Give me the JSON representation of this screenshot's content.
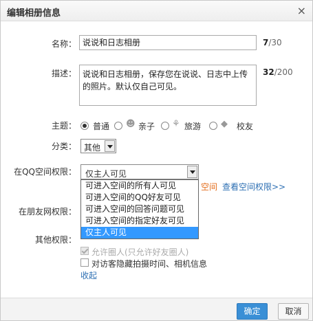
{
  "dialog": {
    "title": "编辑相册信息",
    "close_icon": "×"
  },
  "form": {
    "name_label": "名称：",
    "name_value": "说说和日志相册",
    "name_count_current": "7",
    "name_count_max": "/30",
    "desc_label": "描述：",
    "desc_value": "说说和日志相册，保存您在说说、日志中上传的照片。默认仅自己可见。",
    "desc_count_current": "32",
    "desc_count_max": "/200",
    "theme_label": "主题：",
    "themes": [
      {
        "label": "普通",
        "selected": true,
        "icon": ""
      },
      {
        "label": "亲子",
        "selected": false,
        "icon": "baby-icon"
      },
      {
        "label": "旅游",
        "selected": false,
        "icon": "palm-tree-icon"
      },
      {
        "label": "校友",
        "selected": false,
        "icon": "graduation-cap-icon"
      }
    ],
    "category_label": "分类：",
    "category_value": "其他",
    "qq_permission_label": "在QQ空间权限：",
    "qq_permission_value": "仅主人可见",
    "permission_options": [
      "可进入空间的所有人可见",
      "可进入空间的QQ好友可见",
      "可进入空间的回答问题可见",
      "可进入空间的指定好友可见",
      "仅主人可见"
    ],
    "space_link_partial": "空间",
    "view_space_permission_link": "查看空间权限>>",
    "friends_permission_label": "在朋友网权限：",
    "other_permission_label": "其他权限：",
    "allow_circle_label": "允许圈人(只允许好友圈人)",
    "hide_exif_label": "对访客隐藏拍摄时间、相机信息",
    "collapse_link": "收起"
  },
  "footer": {
    "ok_label": "确定",
    "cancel_label": "取消"
  },
  "colors": {
    "accent": "#3a8fd6",
    "selected_option": "#3399ff",
    "link": "#2d6fb3",
    "orange": "#e46f1f"
  }
}
